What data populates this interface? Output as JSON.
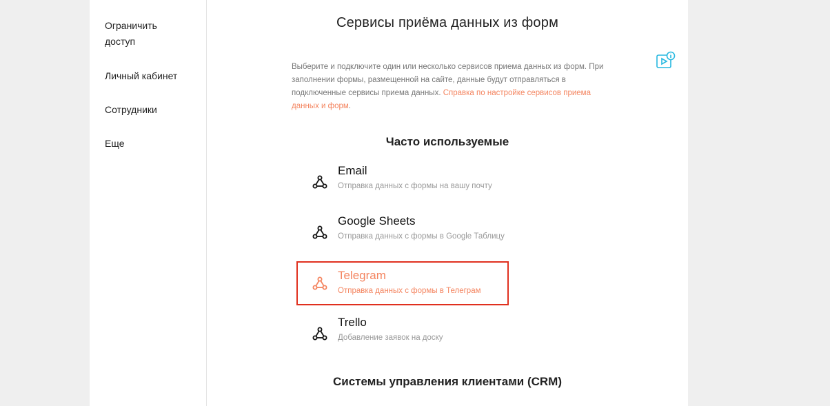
{
  "sidebar": {
    "items": [
      {
        "label": "Ограничить доступ"
      },
      {
        "label": "Личный кабинет"
      },
      {
        "label": "Сотрудники"
      },
      {
        "label": "Еще"
      }
    ]
  },
  "main": {
    "title": "Сервисы приёма данных из форм",
    "description": "Выберите и подключите один или несколько сервисов приема данных из форм. При заполнении формы, размещенной на сайте, данные будут отправляться в подключенные сервисы приема данных.",
    "description_link": "Справка по настройке сервисов приема данных и форм",
    "description_end": ".",
    "help_icon": "video-info-icon",
    "sections": [
      {
        "title": "Часто используемые"
      },
      {
        "title": "Системы управления клиентами (CRM)"
      }
    ],
    "services": [
      {
        "title": "Email",
        "subtitle": "Отправка данных с формы на вашу почту",
        "icon": "connection-icon"
      },
      {
        "title": "Google Sheets",
        "subtitle": "Отправка данных с формы в Google Таблицу",
        "icon": "connection-icon"
      },
      {
        "title": "Telegram",
        "subtitle": "Отправка данных с формы в Телеграм",
        "icon": "connection-icon"
      },
      {
        "title": "Trello",
        "subtitle": "Добавление заявок на доску",
        "icon": "connection-icon"
      }
    ]
  },
  "colors": {
    "accent": "#f4845f",
    "highlight_border": "#e0301e",
    "help_icon": "#27b8e0",
    "background": "#efefef"
  }
}
